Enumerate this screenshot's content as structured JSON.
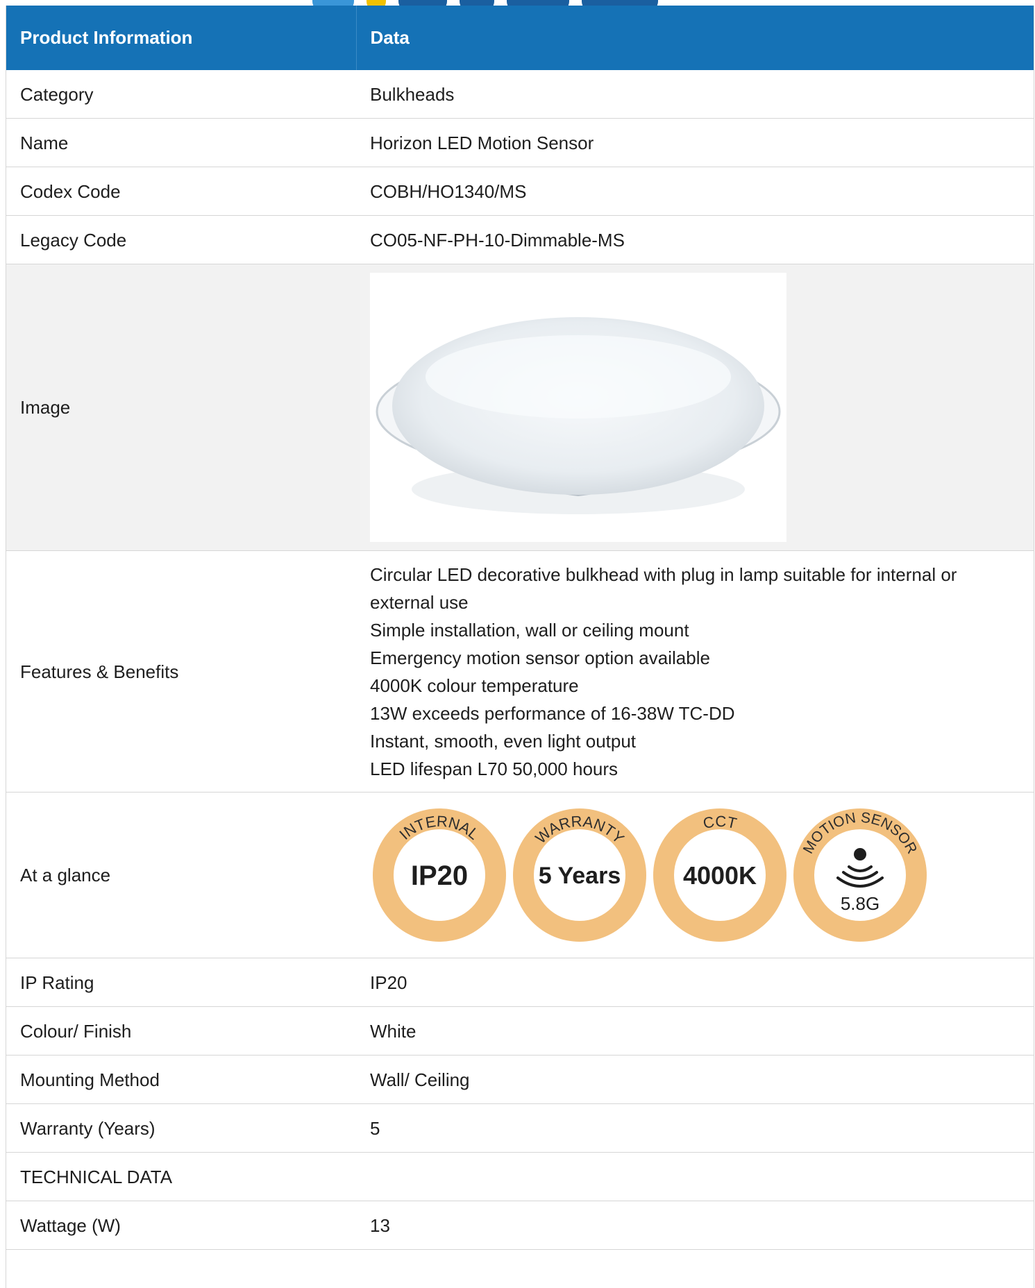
{
  "table": {
    "header": {
      "col1": "Product Information",
      "col2": "Data"
    },
    "rows": {
      "category": {
        "label": "Category",
        "value": "Bulkheads"
      },
      "name": {
        "label": "Name",
        "value": "Horizon LED Motion Sensor"
      },
      "codex": {
        "label": "Codex Code",
        "value": "COBH/HO1340/MS"
      },
      "legacy": {
        "label": "Legacy Code",
        "value": "CO05-NF-PH-10-Dimmable-MS"
      },
      "image": {
        "label": "Image"
      },
      "features": {
        "label": "Features & Benefits",
        "lines": [
          "Circular LED decorative bulkhead with plug in lamp suitable for internal or",
          "external use",
          "Simple installation, wall or ceiling mount",
          "Emergency motion sensor option available",
          "4000K colour temperature",
          "13W exceeds performance of 16-38W TC-DD",
          "Instant, smooth, even light output",
          "LED lifespan L70 50,000 hours"
        ]
      },
      "glance": {
        "label": "At a glance",
        "badges": [
          {
            "top": "INTERNAL",
            "main": "IP20"
          },
          {
            "top": "WARRANTY",
            "main": "5 Years"
          },
          {
            "top": "CCT",
            "main": "4000K"
          },
          {
            "top": "MOTION SENSOR",
            "main": "5.8G"
          }
        ]
      },
      "ip": {
        "label": "IP Rating",
        "value": "IP20"
      },
      "colour": {
        "label": "Colour/ Finish",
        "value": "White"
      },
      "mounting": {
        "label": "Mounting Method",
        "value": "Wall/ Ceiling"
      },
      "warranty": {
        "label": "Warranty (Years)",
        "value": "5"
      },
      "technical": {
        "label": "TECHNICAL DATA"
      },
      "wattage": {
        "label": "Wattage (W)",
        "value": "13"
      }
    }
  },
  "colors": {
    "header_bg": "#1572b6",
    "badge_ring": "#f2c07e",
    "alt_row": "#f2f2f2"
  },
  "icons": {
    "motion": "motion-sensor-waves-icon"
  }
}
